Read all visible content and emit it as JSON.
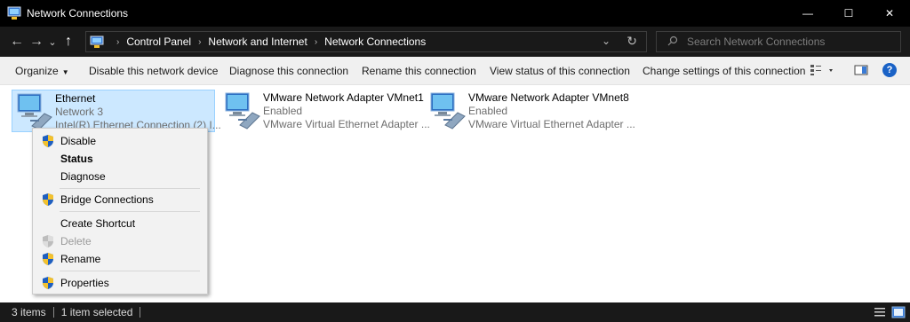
{
  "window": {
    "title": "Network Connections",
    "minimize_glyph": "—",
    "maximize_glyph": "☐",
    "close_glyph": "✕"
  },
  "nav": {
    "back_glyph": "←",
    "forward_glyph": "→",
    "recent_glyph": "⌄",
    "up_glyph": "↑"
  },
  "address": {
    "breadcrumbs": [
      "Control Panel",
      "Network and Internet",
      "Network Connections"
    ],
    "separator_glyph": "›",
    "dropdown_glyph": "⌄",
    "refresh_glyph": "↻"
  },
  "search": {
    "placeholder": "Search Network Connections"
  },
  "commands": {
    "organize": "Organize",
    "caret": "▼",
    "disable_device": "Disable this network device",
    "diagnose": "Diagnose this connection",
    "rename": "Rename this connection",
    "view_status": "View status of this connection",
    "change_settings": "Change settings of this connection",
    "help": "?"
  },
  "items": [
    {
      "name": "Ethernet",
      "status": "Network 3",
      "device": "Intel(R) Ethernet Connection (2) I...",
      "selected": true,
      "connected": true
    },
    {
      "name": "VMware Network Adapter VMnet1",
      "status": "Enabled",
      "device": "VMware Virtual Ethernet Adapter ...",
      "selected": false,
      "connected": false
    },
    {
      "name": "VMware Network Adapter VMnet8",
      "status": "Enabled",
      "device": "VMware Virtual Ethernet Adapter ...",
      "selected": false,
      "connected": false
    }
  ],
  "context_menu": {
    "disable": "Disable",
    "status": "Status",
    "diagnose": "Diagnose",
    "bridge": "Bridge Connections",
    "create_shortcut": "Create Shortcut",
    "delete": "Delete",
    "rename": "Rename",
    "properties": "Properties"
  },
  "statusbar": {
    "items_count": "3 items",
    "selected": "1 item selected"
  },
  "colors": {
    "titlebar": "#000000",
    "toolbar_dark": "#191919",
    "selection": "#cce8ff",
    "selection_border": "#99d1ff",
    "shield_blue": "#1f5fbf",
    "shield_yellow": "#f2c12e",
    "help_blue": "#1a62c6"
  },
  "icons": [
    "network-connections-app-icon",
    "network-adapter-icon",
    "uac-shield-icon",
    "search-icon",
    "view-options-icon",
    "preview-pane-icon",
    "help-icon",
    "details-view-icon",
    "large-icons-view-icon"
  ]
}
